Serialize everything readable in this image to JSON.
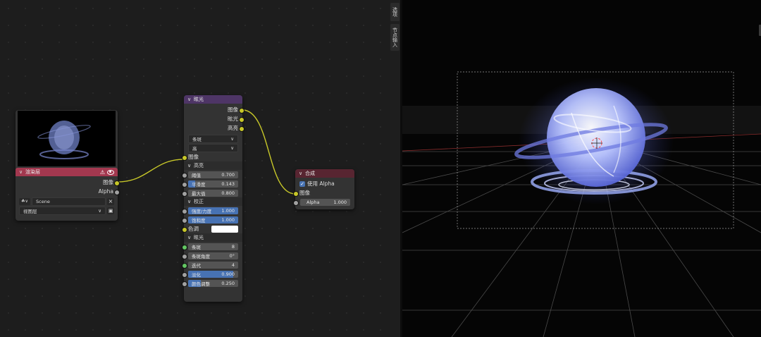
{
  "sidebar_tabs": [
    "选项",
    "节点输入"
  ],
  "render_layers_node": {
    "title": "渲染层",
    "outputs": [
      "图像",
      "Alpha"
    ],
    "scene": "Scene",
    "view_layer": "视图层"
  },
  "glare_node": {
    "title": "眩光",
    "outputs": [
      "图像",
      "眩光",
      "高亮"
    ],
    "glare_type": "条斑",
    "quality": "高",
    "input_label": "图像",
    "highlights": {
      "title": "高亮",
      "fields": [
        {
          "label": "阈值",
          "value": "0.700",
          "fill": 0
        },
        {
          "label": "平滑度",
          "value": "0.143",
          "fill": 0.143
        },
        {
          "label": "最大值",
          "value": "0.800",
          "fill": 0
        }
      ]
    },
    "adjust": {
      "title": "校正",
      "fields": [
        {
          "label": "强度/力度",
          "value": "1.000",
          "fill": 1
        },
        {
          "label": "饱和度",
          "value": "1.000",
          "fill": 1
        }
      ],
      "tint_label": "色调",
      "tint_color": "#ffffff"
    },
    "glare": {
      "title": "眩光",
      "fields": [
        {
          "label": "条斑",
          "value": "8",
          "fill": 0
        },
        {
          "label": "条斑角度",
          "value": "0°",
          "fill": 0
        },
        {
          "label": "迭代",
          "value": "4",
          "fill": 0
        },
        {
          "label": "淡化",
          "value": "0.900",
          "fill": 0.9
        },
        {
          "label": "颜色调整",
          "value": "0.250",
          "fill": 0.25
        }
      ]
    }
  },
  "composite_node": {
    "title": "合成",
    "use_alpha_label": "使用 Alpha",
    "use_alpha": true,
    "input_label": "图像",
    "alpha_label": "Alpha",
    "alpha_value": "1.000"
  },
  "colors": {
    "render_header": "#a3384f",
    "glare_header": "#4e3566",
    "composite_header": "#582531",
    "accent": "#4772b3",
    "socket_yellow": "#c7c729"
  }
}
